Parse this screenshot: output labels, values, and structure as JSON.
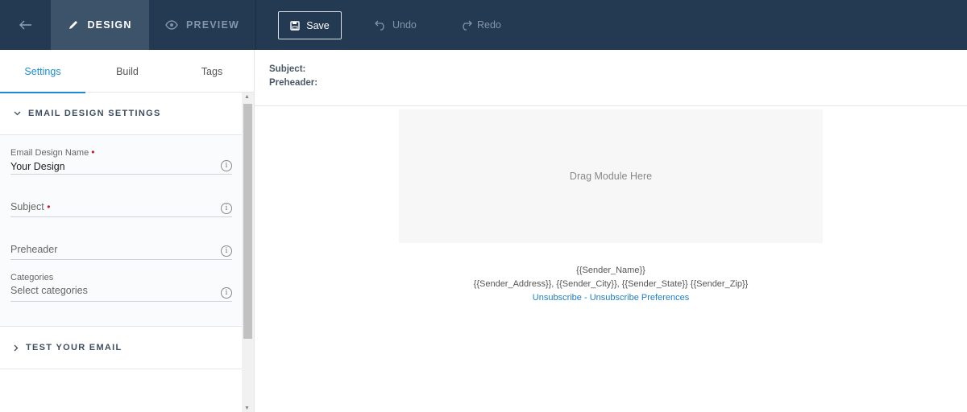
{
  "topbar": {
    "back_icon": "arrow-left-icon",
    "design_tab": {
      "label": "DESIGN",
      "icon": "pencil-icon"
    },
    "preview_tab": {
      "label": "PREVIEW",
      "icon": "eye-icon"
    },
    "save_label": "Save",
    "undo_label": "Undo",
    "redo_label": "Redo",
    "colors": {
      "bar": "#233a52",
      "active_tab": "#3d536a"
    }
  },
  "left_panel": {
    "tabs": [
      {
        "label": "Settings",
        "active": true
      },
      {
        "label": "Build",
        "active": false
      },
      {
        "label": "Tags",
        "active": false
      }
    ],
    "settings_section": {
      "title": "EMAIL DESIGN SETTINGS",
      "expanded": true,
      "fields": {
        "design_name": {
          "label": "Email Design Name",
          "required_mark": "•",
          "value": "Your Design"
        },
        "subject": {
          "label": "Subject",
          "required_mark": "•",
          "value": ""
        },
        "preheader": {
          "placeholder": "Preheader",
          "value": ""
        },
        "categories": {
          "label": "Categories",
          "placeholder": "Select categories"
        }
      },
      "info_glyph": "i"
    },
    "test_section": {
      "title": "TEST YOUR EMAIL",
      "expanded": false
    }
  },
  "canvas": {
    "subject_label": "Subject:",
    "preheader_label": "Preheader:",
    "drop_zone_text": "Drag Module Here",
    "footer": {
      "sender_name": "{{Sender_Name}}",
      "sender_address": "{{Sender_Address}}, {{Sender_City}}, {{Sender_State}} {{Sender_Zip}}",
      "unsubscribe": "Unsubscribe",
      "separator": " - ",
      "unsubscribe_prefs": "Unsubscribe Preferences"
    },
    "accent_color": "#1d8bd1"
  }
}
